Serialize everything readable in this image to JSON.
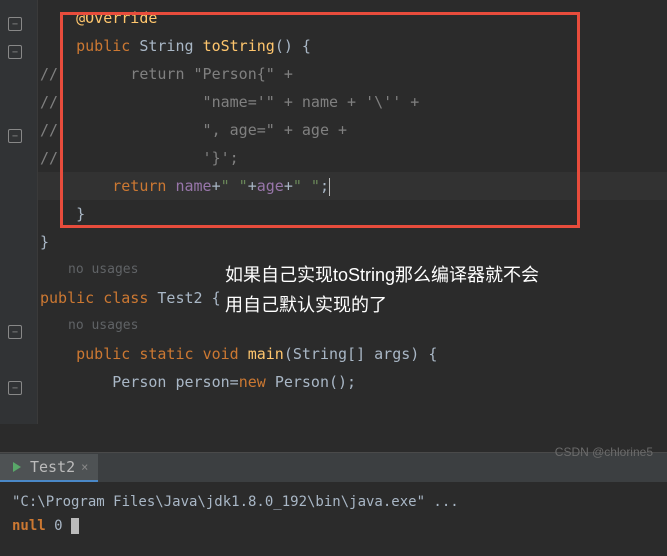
{
  "code": {
    "annotation_top": "@Override",
    "l1_pre": "    ",
    "l1_public": "public",
    "l1_type": " String ",
    "l1_method": "toString",
    "l1_post": "() {",
    "l2": "//        return \"Person{\" +",
    "l3": "//                \"name='\" + name + '\\'' +",
    "l4": "//                \", age=\" + age +",
    "l5": "//                '}';",
    "l6_indent": "        ",
    "l6_return": "return",
    "l6_sp1": " ",
    "l6_name": "name",
    "l6_plus1": "+",
    "l6_str1": "\" \"",
    "l6_plus2": "+",
    "l6_age": "age",
    "l6_plus3": "+",
    "l6_str2": "\" \"",
    "l6_semi": ";",
    "l7": "    }",
    "l8": "}",
    "hint": "no usages",
    "l10_public": "public",
    "l10_class": " class ",
    "l10_name": "Test2 ",
    "l10_brace": "{",
    "hint2": "no usages",
    "l12_indent": "    ",
    "l12_public": "public",
    "l12_static": " static ",
    "l12_void": "void",
    "l12_sp": " ",
    "l12_main": "main",
    "l12_args": "(String[] args) {",
    "l13_indent": "        ",
    "l13_type": "Person ",
    "l13_var": "person",
    "l13_eq": "=",
    "l13_new": "new",
    "l13_sp": " ",
    "l13_ctor": "Person();"
  },
  "annotation": {
    "line1": "如果自己实现toString那么编译器就不会",
    "line2": "用自己默认实现的了"
  },
  "tab": {
    "name": "Test2"
  },
  "console": {
    "cmd": "\"C:\\Program Files\\Java\\jdk1.8.0_192\\bin\\java.exe\" ...",
    "out_null": "null",
    "out_val": " 0 "
  },
  "watermark": "CSDN @chlorine5"
}
